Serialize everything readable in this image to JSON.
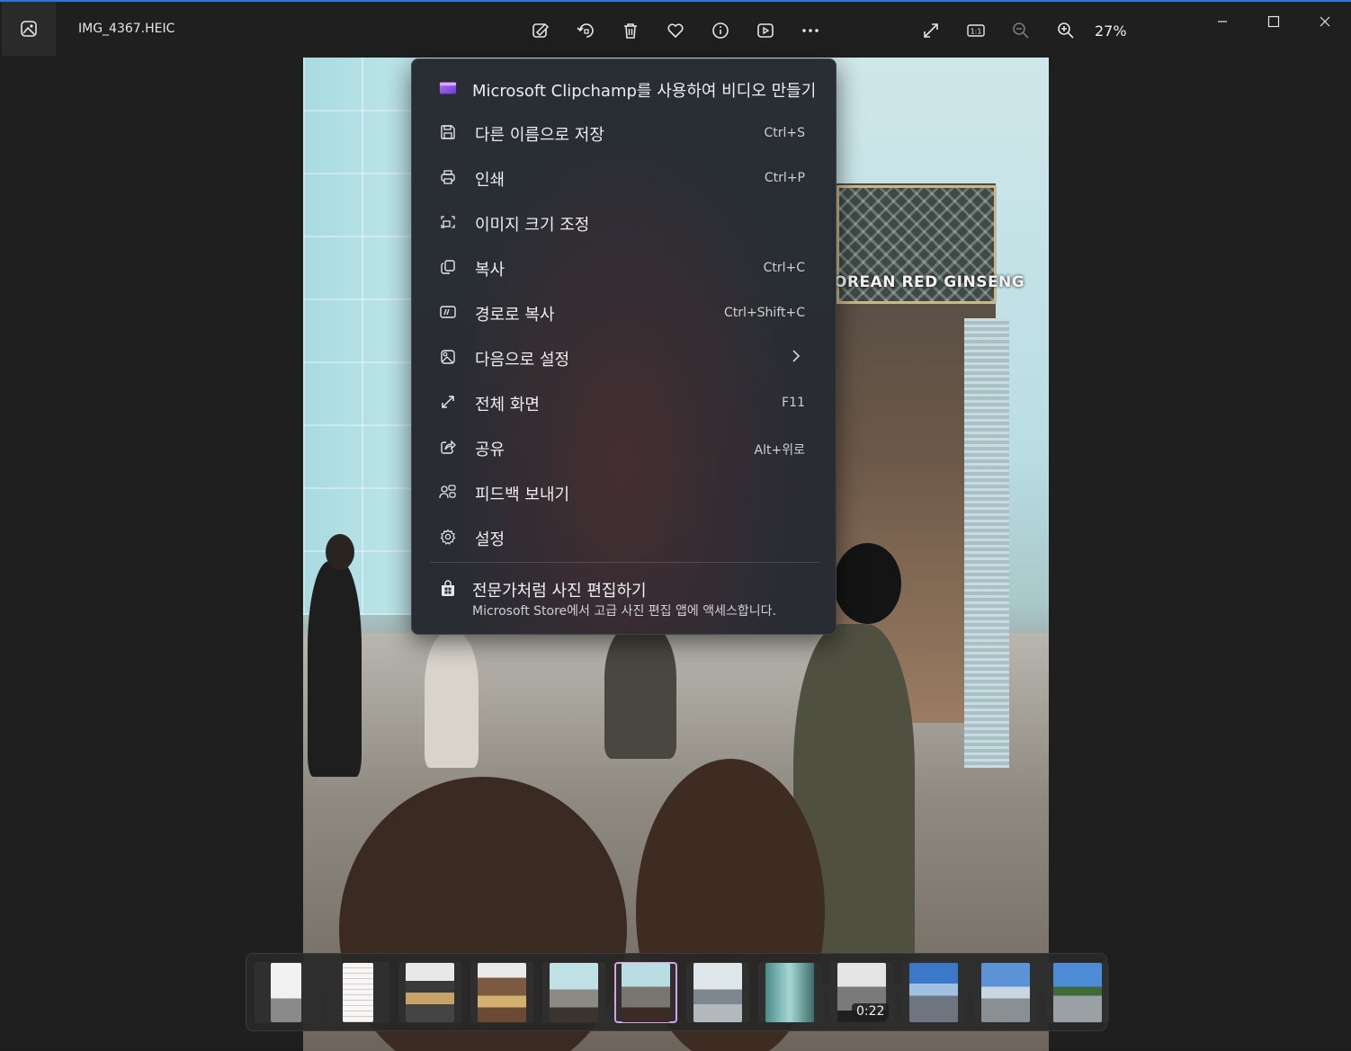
{
  "window": {
    "file_name": "IMG_4367.HEIC",
    "zoom_level": "27%",
    "accent": "#2b78d4"
  },
  "toolbar": {
    "icons": [
      "edit-image-icon",
      "rotate-icon",
      "delete-icon",
      "favorite-icon",
      "info-icon",
      "slideshow-icon",
      "more-icon"
    ],
    "view_icons": [
      "fullscreen-icon",
      "actual-size-icon",
      "zoom-out-icon",
      "zoom-in-icon"
    ]
  },
  "photo": {
    "sign_text": "OREAN RED GINSENG"
  },
  "menu": {
    "items": [
      {
        "label": "Microsoft Clipchamp를 사용하여 비디오 만들기",
        "shortcut": "",
        "icon": "clipchamp-icon"
      },
      {
        "label": "다른 이름으로 저장",
        "shortcut": "Ctrl+S",
        "icon": "save-icon"
      },
      {
        "label": "인쇄",
        "shortcut": "Ctrl+P",
        "icon": "print-icon"
      },
      {
        "label": "이미지 크기 조정",
        "shortcut": "",
        "icon": "resize-icon"
      },
      {
        "label": "복사",
        "shortcut": "Ctrl+C",
        "icon": "copy-icon"
      },
      {
        "label": "경로로 복사",
        "shortcut": "Ctrl+Shift+C",
        "icon": "copy-path-icon"
      },
      {
        "label": "다음으로 설정",
        "shortcut": "",
        "icon": "set-as-icon"
      },
      {
        "label": "전체 화면",
        "shortcut": "F11",
        "icon": "fullscreen-icon"
      },
      {
        "label": "공유",
        "shortcut": "Alt+위로",
        "icon": "share-icon"
      },
      {
        "label": "피드백 보내기",
        "shortcut": "",
        "icon": "feedback-icon"
      },
      {
        "label": "설정",
        "shortcut": "",
        "icon": "settings-icon"
      }
    ],
    "promo": {
      "title": "전문가처럼 사진 편집하기",
      "subtitle": "Microsoft Store에서 고급 사진 편집 앱에 액세스합니다."
    }
  },
  "filmstrip": {
    "selected_index": 5,
    "video_duration": "0:22"
  }
}
